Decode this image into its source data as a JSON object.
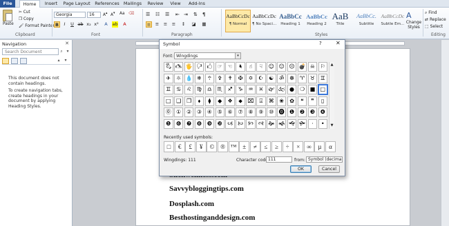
{
  "tabs": [
    "File",
    "Home",
    "Insert",
    "Page Layout",
    "References",
    "Mailings",
    "Review",
    "View",
    "Add-Ins"
  ],
  "clipboard": {
    "paste": "Paste",
    "cut": "Cut",
    "copy": "Copy",
    "format_painter": "Format Painter",
    "label": "Clipboard"
  },
  "font_group": {
    "font_name": "Georgia",
    "font_size": "16",
    "label": "Font",
    "bold": "B",
    "italic": "I",
    "underline": "U"
  },
  "paragraph_group": {
    "label": "Paragraph"
  },
  "styles": [
    {
      "sample": "AaBbCcDc",
      "name": "¶ Normal"
    },
    {
      "sample": "AaBbCcDc",
      "name": "¶ No Spaci..."
    },
    {
      "sample": "AaBbCc",
      "name": "Heading 1"
    },
    {
      "sample": "AaBbCc",
      "name": "Heading 2"
    },
    {
      "sample": "AaB",
      "name": "Title"
    },
    {
      "sample": "AaBbCc.",
      "name": "Subtitle"
    },
    {
      "sample": "AaBbCcDc",
      "name": "Subtle Em..."
    }
  ],
  "styles_label": "Styles",
  "change_styles": "Change Styles",
  "editing": {
    "find": "Find",
    "replace": "Replace",
    "select": "Select",
    "label": "Editing"
  },
  "nav": {
    "title": "Navigation",
    "search_placeholder": "Search Document",
    "msg1": "This document does not contain headings.",
    "msg2": "To create navigation tabs, create headings in your document by applying Heading Styles."
  },
  "document_lines": [
    "Slickwellness.com",
    "Savvybloggingtips.com",
    "Dosplash.com",
    "Besthostinganddesign.com"
  ],
  "dialog": {
    "title": "Symbol",
    "help": "?",
    "close": "✕",
    "font_label": "Font:",
    "font_value": "Wingdings",
    "symbols": [
      [
        "🖏",
        "🖎",
        "🖐",
        "🖓",
        "🖒",
        "☞",
        "☜",
        "🖣",
        "☝",
        "☟",
        "☺",
        "😐",
        "☹",
        "💣",
        "☠",
        "⚐"
      ],
      [
        "✈",
        "☼",
        "💧",
        "❄",
        "🕆",
        "✞",
        "🕈",
        "✠",
        "✡",
        "☪",
        "☯",
        "ॐ",
        "☸",
        "♈",
        "♉",
        "♊"
      ],
      [
        "♊",
        "♋",
        "♌",
        "♍",
        "♎",
        "♏",
        "♐",
        "♑",
        "♒",
        "♓",
        "🙰",
        "🙵",
        "●",
        "❍",
        "■",
        "□"
      ],
      [
        "□",
        "❑",
        "❒",
        "⬧",
        "⧫",
        "◆",
        "❖",
        "⬥",
        "⌧",
        "⍓",
        "⌘",
        "❀",
        "✿",
        "❝",
        "❞",
        "▯"
      ],
      [
        "⓪",
        "①",
        "②",
        "③",
        "④",
        "⑤",
        "⑥",
        "⑦",
        "⑧",
        "⑨",
        "⑩",
        "⓿",
        "❶",
        "❷",
        "❸",
        "❹"
      ],
      [
        "❺",
        "❻",
        "❼",
        "❽",
        "❾",
        "❿",
        "🙢",
        "🙠",
        "🙡",
        "🙣",
        "🙞",
        "🙜",
        "🙝",
        "🙟",
        "·",
        "•"
      ]
    ],
    "recent_label": "Recently used symbols:",
    "recent": [
      "□",
      "€",
      "£",
      "¥",
      "©",
      "®",
      "™",
      "±",
      "≠",
      "≤",
      "≥",
      "÷",
      "×",
      "∞",
      "µ",
      "α"
    ],
    "char_name": "Wingdings: 111",
    "char_code_label": "Character code:",
    "char_code": "111",
    "from_label": "from:",
    "from_value": "Symbol (decimal)",
    "ok": "OK",
    "cancel": "Cancel"
  },
  "colors": {
    "file_tab": "#2a5699",
    "selection": "#3b77d9",
    "highlight": "#fde9a7"
  }
}
